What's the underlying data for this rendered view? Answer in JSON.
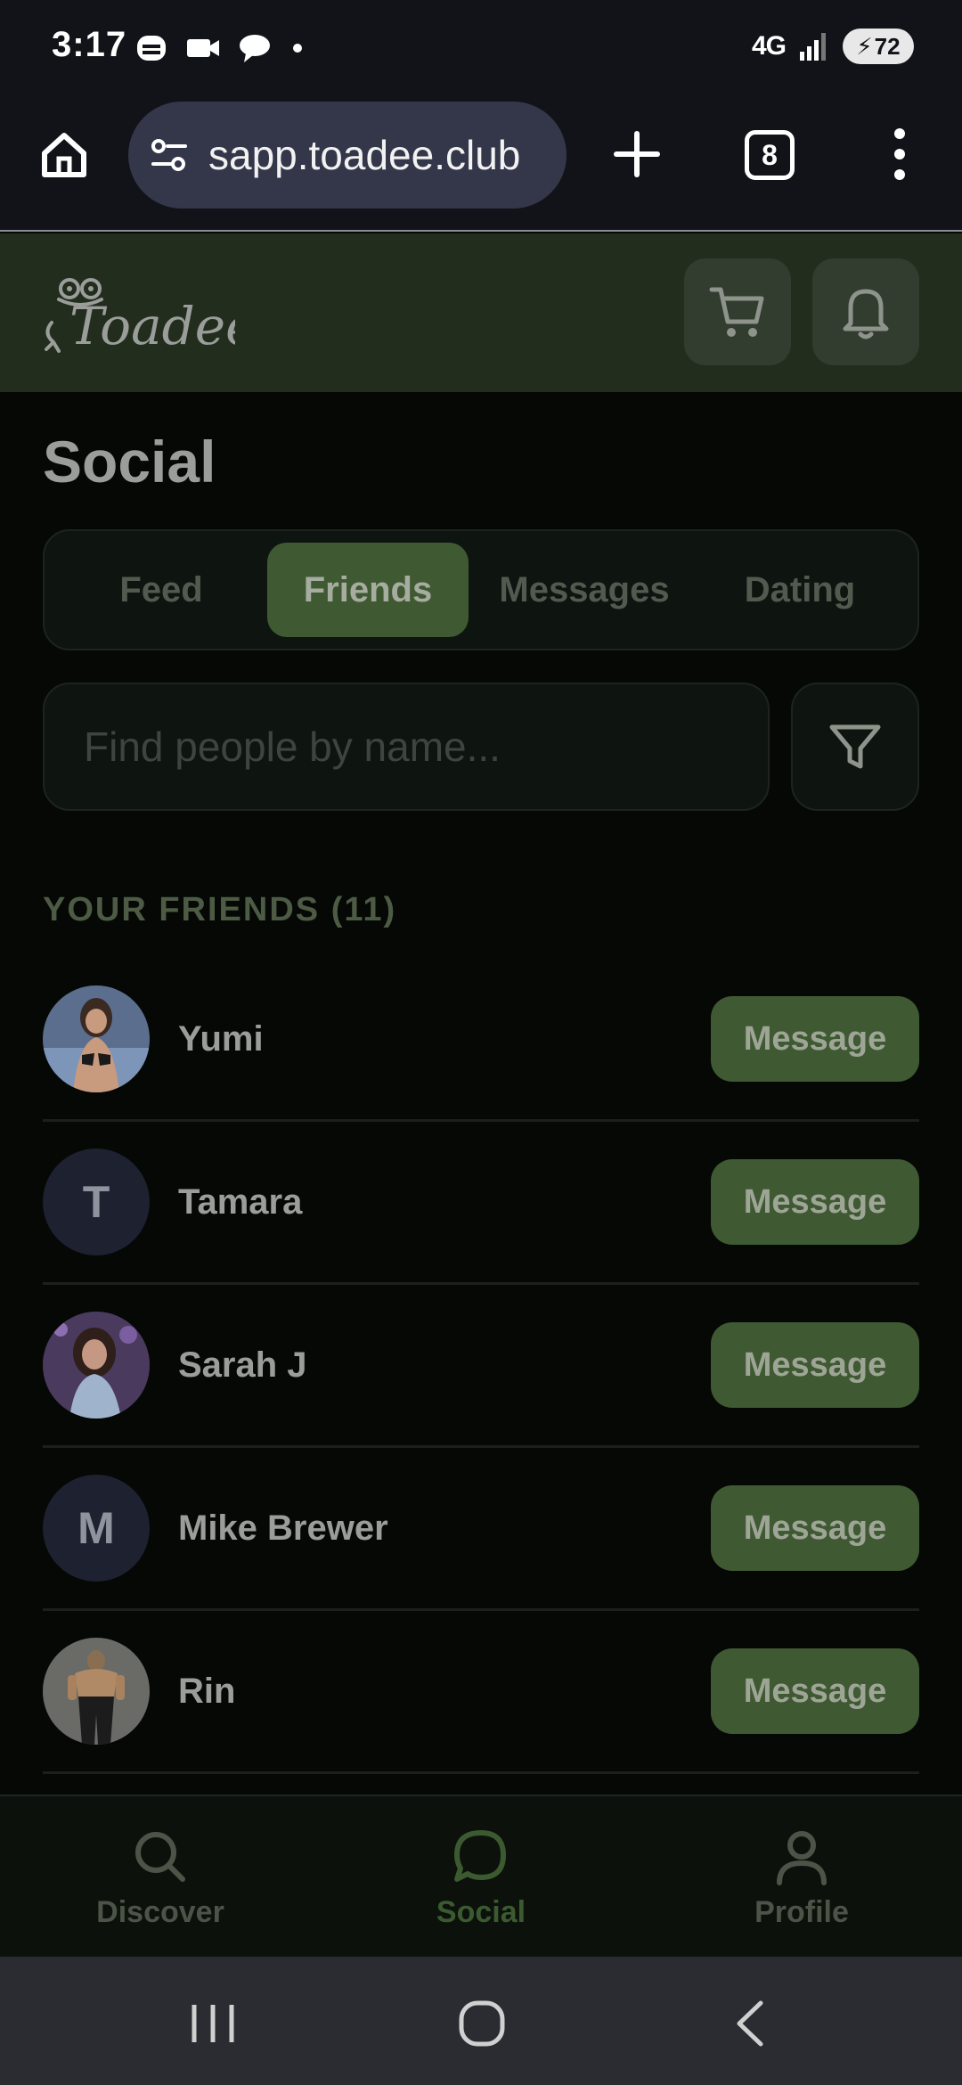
{
  "status_bar": {
    "time": "3:17",
    "network": "4G",
    "battery": "72"
  },
  "browser": {
    "url": "sapp.toadee.club",
    "tab_count": "8"
  },
  "app": {
    "brand": "Toadee",
    "accent_color": "#3f5a32",
    "header_color": "#222d1e"
  },
  "page": {
    "title": "Social",
    "tabs": [
      {
        "label": "Feed",
        "active": false
      },
      {
        "label": "Friends",
        "active": true
      },
      {
        "label": "Messages",
        "active": false
      },
      {
        "label": "Dating",
        "active": false
      }
    ],
    "search_placeholder": "Find people by name...",
    "friends_heading": "YOUR FRIENDS (11)",
    "friends": [
      {
        "name": "Yumi",
        "initial": "",
        "photo": true,
        "action": "Message"
      },
      {
        "name": "Tamara",
        "initial": "T",
        "photo": false,
        "action": "Message"
      },
      {
        "name": "Sarah J",
        "initial": "",
        "photo": true,
        "action": "Message"
      },
      {
        "name": "Mike Brewer",
        "initial": "M",
        "photo": false,
        "action": "Message"
      },
      {
        "name": "Rin",
        "initial": "",
        "photo": true,
        "action": "Message"
      }
    ]
  },
  "bottom_nav": {
    "items": [
      {
        "label": "Discover",
        "icon": "search-icon",
        "active": false
      },
      {
        "label": "Social",
        "icon": "chat-bubble-icon",
        "active": true
      },
      {
        "label": "Profile",
        "icon": "user-icon",
        "active": false
      }
    ]
  }
}
